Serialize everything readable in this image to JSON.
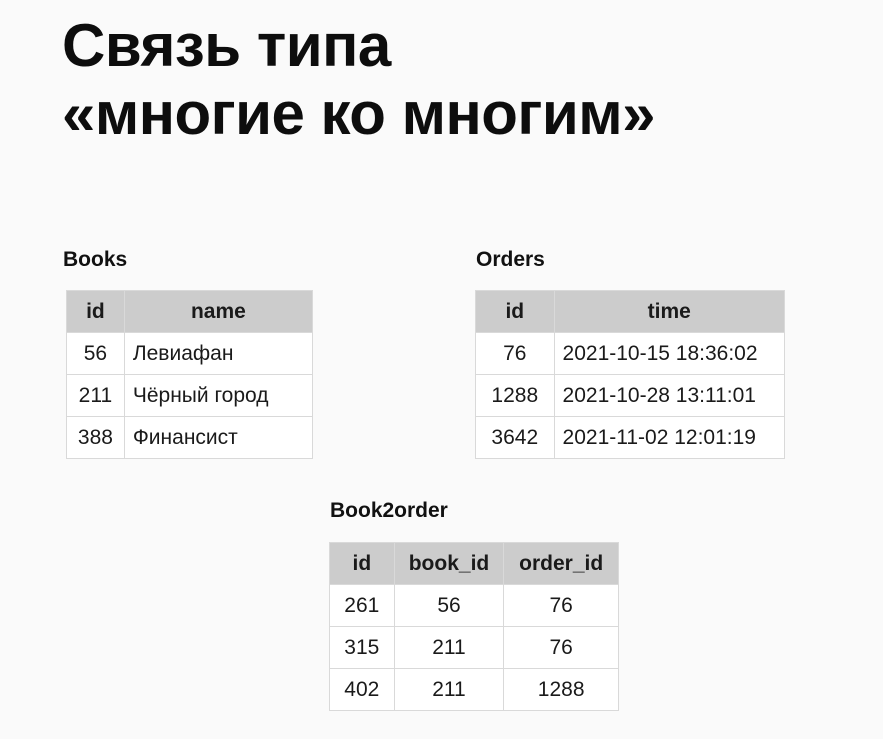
{
  "title": {
    "line1": "Связь типа",
    "line2": "«многие ко многим»"
  },
  "books": {
    "caption": "Books",
    "headers": [
      "id",
      "name"
    ],
    "rows": [
      [
        "56",
        "Левиафан"
      ],
      [
        "211",
        "Чёрный город"
      ],
      [
        "388",
        "Финансист"
      ]
    ]
  },
  "orders": {
    "caption": "Orders",
    "headers": [
      "id",
      "time"
    ],
    "rows": [
      [
        "76",
        "2021-10-15 18:36:02"
      ],
      [
        "1288",
        "2021-10-28 13:11:01"
      ],
      [
        "3642",
        "2021-11-02 12:01:19"
      ]
    ]
  },
  "book2order": {
    "caption": "Book2order",
    "headers": [
      "id",
      "book_id",
      "order_id"
    ],
    "rows": [
      [
        "261",
        "56",
        "76"
      ],
      [
        "315",
        "211",
        "76"
      ],
      [
        "402",
        "211",
        "1288"
      ]
    ]
  },
  "colors": {
    "background": "#fafafa",
    "header_fill": "#cccccc",
    "cell_border": "#d9d9d9",
    "text": "#111111"
  }
}
